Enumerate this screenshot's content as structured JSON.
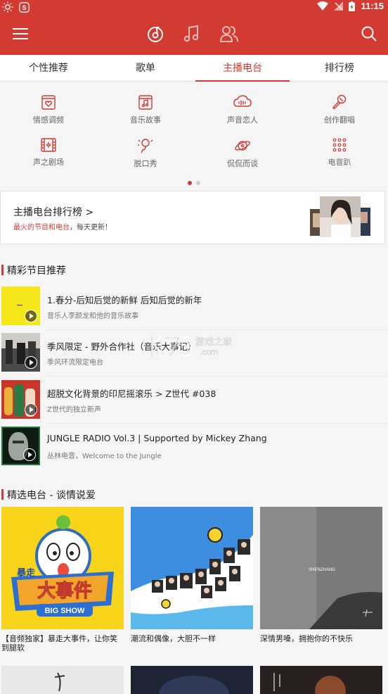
{
  "status_bar": {
    "time": "11:15"
  },
  "tabs": [
    {
      "label": "个性推荐",
      "active": false
    },
    {
      "label": "歌单",
      "active": false
    },
    {
      "label": "主播电台",
      "active": true
    },
    {
      "label": "排行榜",
      "active": false
    }
  ],
  "categories": [
    {
      "label": "情感调频",
      "icon": "heart-radio-icon"
    },
    {
      "label": "音乐故事",
      "icon": "music-note-icon"
    },
    {
      "label": "声音恋人",
      "icon": "cloud-voice-icon"
    },
    {
      "label": "创作翻唱",
      "icon": "microphone-icon"
    },
    {
      "label": "声之剧场",
      "icon": "film-icon"
    },
    {
      "label": "脱口秀",
      "icon": "mic-stand-icon"
    },
    {
      "label": "侃侃而谈",
      "icon": "planet-icon"
    },
    {
      "label": "电音趴",
      "icon": "dots-grid-icon"
    }
  ],
  "rank_banner": {
    "title": "主播电台排行榜 >",
    "sub_highlight": "最火的节目和电台",
    "sub_rest": "，每天更新！"
  },
  "section_programs": {
    "title": "精彩节目推荐"
  },
  "programs": [
    {
      "title": "1.春分-后知后觉的新鲜 后知后觉的新年",
      "subtitle": "音乐人李颜龙和他的音乐故事"
    },
    {
      "title": "季风限定 - 野外合作社（音乐大事记）",
      "subtitle": "季风环流限定电台"
    },
    {
      "title": "超脱文化背景的印尼摇滚乐 > Z世代 #038",
      "subtitle": "Z世代的独立新声"
    },
    {
      "title": "JUNGLE RADIO Vol.3 | Supported by Mickey Zhang",
      "subtitle": "丛林电音，Welcome to the Jungle"
    }
  ],
  "section_radios": {
    "title": "精选电台 - 谈情说爱"
  },
  "radios": [
    {
      "caption": "【音频独家】暴走大事件，让你笑到腿软",
      "cover_text_top": "暴走",
      "cover_text_main": "大事件",
      "cover_text_en": "BIG SHOW"
    },
    {
      "caption": "潮流和偶像，大胆不一样"
    },
    {
      "caption": "深情男嗓，拥抱你的不快乐",
      "cover_text": "SHENZHANG"
    }
  ],
  "watermark": {
    "text_cn": "游戏之家",
    "text_en": "K73",
    "domain": ".com"
  },
  "colors": {
    "brand": "#d33a31",
    "background": "#f5f5f6"
  }
}
